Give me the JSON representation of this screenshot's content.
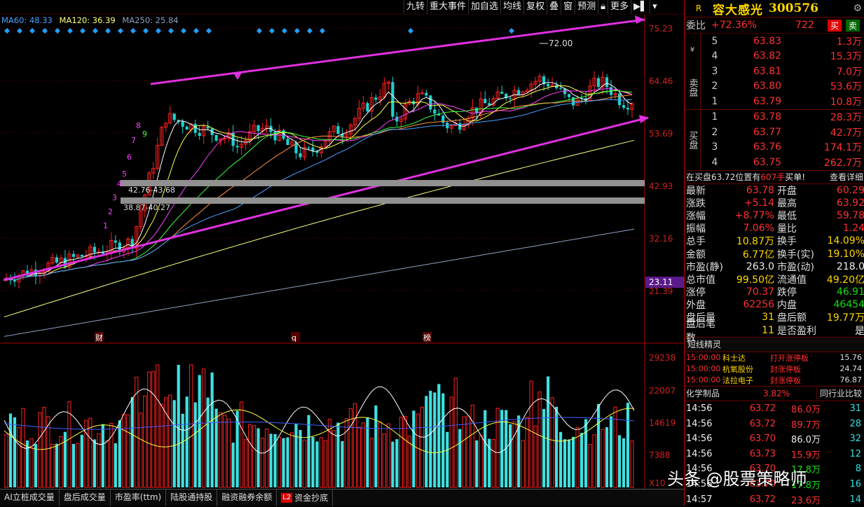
{
  "toolbar": {
    "items": [
      "九转",
      "重大事件",
      "加自选",
      "均线",
      "复权",
      "叠",
      "窗",
      "预测",
      "更多"
    ]
  },
  "legend": {
    "ma60": "MA60: 48.33",
    "ma120": "MA120: 36.39",
    "ma250": "MA250: 25.84",
    "colors": {
      "ma60": "#4aa0ff",
      "ma120": "#ffff80",
      "ma250": "#8aa0c0"
    }
  },
  "price_axis": [
    "75.23",
    "64.46",
    "53.69",
    "42.93",
    "32.16",
    "21.39"
  ],
  "current_price_tag": "23.11",
  "volume_axis": [
    "29238",
    "22007",
    "14619",
    "7388",
    "X10"
  ],
  "annotations": {
    "peak": "72.00",
    "band1": "42.76-43.68",
    "band2": "38.87-40.27",
    "nine_turn": [
      "1",
      "2",
      "3",
      "4",
      "5",
      "6",
      "7",
      "8",
      "9"
    ]
  },
  "event_marks": [
    "财",
    "q",
    "榜"
  ],
  "bottom_tabs": [
    "AI立桩成交量",
    "盘后成交量",
    "市盈率(ttm)",
    "陆股通持股",
    "融资融券余额",
    "资金抄底"
  ],
  "bottom_tab_badge": "L2",
  "stock": {
    "flag": "R",
    "name": "容大感光",
    "code": "300576"
  },
  "weibi": {
    "label": "委比",
    "value": "+72.36%",
    "diff": "722",
    "buy_label": "买",
    "sell_label": "卖"
  },
  "sell_orders": [
    {
      "level": "5",
      "price": "63.83",
      "vol": "1.3万"
    },
    {
      "level": "4",
      "price": "63.82",
      "vol": "15.3万"
    },
    {
      "level": "3",
      "price": "63.81",
      "vol": "7.0万"
    },
    {
      "level": "2",
      "price": "63.80",
      "vol": "53.6万"
    },
    {
      "level": "1",
      "price": "63.79",
      "vol": "10.8万"
    }
  ],
  "sell_side_label": "卖盘",
  "sell_side_prefix": "¥",
  "buy_orders": [
    {
      "level": "1",
      "price": "63.78",
      "vol": "28.3万"
    },
    {
      "level": "2",
      "price": "63.77",
      "vol": "42.7万"
    },
    {
      "level": "3",
      "price": "63.76",
      "vol": "174.1万"
    },
    {
      "level": "4",
      "price": "63.75",
      "vol": "262.7万"
    }
  ],
  "buy_side_label": "买盘",
  "info_line": {
    "text_prefix": "在买盘63.72位置有",
    "text_vol": "607手",
    "text_suffix": "买单!",
    "link": "查看详细"
  },
  "stats": [
    {
      "l1": "最新",
      "v1": "63.78",
      "c1": "red",
      "l2": "开盘",
      "v2": "60.29",
      "c2": "red"
    },
    {
      "l1": "涨跌",
      "v1": "+5.14",
      "c1": "red",
      "l2": "最高",
      "v2": "63.92",
      "c2": "red"
    },
    {
      "l1": "涨幅",
      "v1": "+8.77%",
      "c1": "red",
      "l2": "最低",
      "v2": "59.78",
      "c2": "red"
    },
    {
      "l1": "振幅",
      "v1": "7.06%",
      "c1": "red",
      "l2": "量比",
      "v2": "1.24",
      "c2": "red"
    },
    {
      "l1": "总手",
      "v1": "10.87万",
      "c1": "yellow",
      "l2": "换手",
      "v2": "14.09%",
      "c2": "yellow"
    },
    {
      "l1": "金额",
      "v1": "6.77亿",
      "c1": "yellow",
      "l2": "换手(实)",
      "v2": "19.10%",
      "c2": "yellow"
    },
    {
      "l1": "市盈(静)",
      "v1": "263.0",
      "c1": "white",
      "l2": "市盈(动)",
      "v2": "218.0",
      "c2": "white"
    },
    {
      "l1": "总市值",
      "v1": "99.50亿",
      "c1": "yellow",
      "l2": "流通值",
      "v2": "49.20亿",
      "c2": "yellow"
    },
    {
      "l1": "涨停",
      "v1": "70.37",
      "c1": "red",
      "l2": "跌停",
      "v2": "46.91",
      "c2": "green"
    },
    {
      "l1": "外盘",
      "v1": "62256",
      "c1": "red",
      "l2": "内盘",
      "v2": "46454",
      "c2": "green"
    },
    {
      "l1": "盘后量",
      "v1": "31",
      "c1": "yellow",
      "l2": "盘后额",
      "v2": "19.77万",
      "c2": "yellow"
    },
    {
      "l1": "盘后笔数",
      "v1": "11",
      "c1": "yellow",
      "l2": "是否盈利",
      "v2": "是",
      "c2": "white"
    }
  ],
  "sprite": {
    "title": "短线精灵",
    "rows": [
      {
        "time": "15:00:00",
        "name": "科士达",
        "event": "打开涨停板",
        "pct": "15.76"
      },
      {
        "time": "15:00:00",
        "name": "杭氧股份",
        "event": "封涨停板",
        "pct": "24.74"
      },
      {
        "time": "15:00:00",
        "name": "法拉电子",
        "event": "封涨停板",
        "pct": "76.87"
      }
    ]
  },
  "industry": {
    "name": "化学制品",
    "pct": "3.82%",
    "link": "同行业比较"
  },
  "ticks": [
    {
      "time": "14:56",
      "price": "63.72",
      "vol": "86.0万",
      "vcolor": "red",
      "n": "31"
    },
    {
      "time": "14:56",
      "price": "63.72",
      "vol": "89.7万",
      "vcolor": "red",
      "n": "28"
    },
    {
      "time": "14:56",
      "price": "63.70",
      "vol": "86.0万",
      "vcolor": "white",
      "n": "32"
    },
    {
      "time": "14:56",
      "price": "63.73",
      "vol": "15.9万",
      "vcolor": "red",
      "n": "12"
    },
    {
      "time": "14:56",
      "price": "63.70",
      "vol": "17.8万",
      "vcolor": "green",
      "n": "8"
    },
    {
      "time": "14:56",
      "price": "63.70",
      "vol": "17.8万",
      "vcolor": "green",
      "n": "16"
    },
    {
      "time": "14:57",
      "price": "63.72",
      "vol": "23.6万",
      "vcolor": "red",
      "n": "14"
    }
  ],
  "watermark": "头条 @股票策略师"
}
